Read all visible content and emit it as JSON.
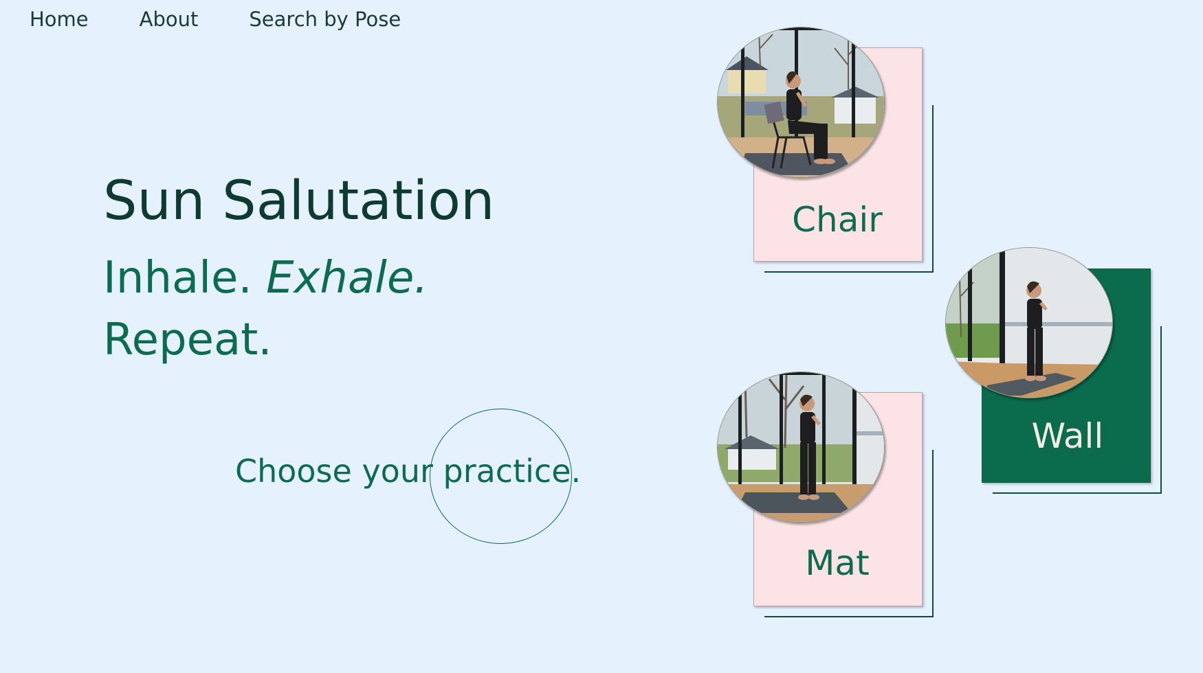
{
  "nav": {
    "items": [
      {
        "label": "Home"
      },
      {
        "label": "About"
      },
      {
        "label": "Search by Pose"
      }
    ]
  },
  "hero": {
    "title": "Sun Salutation",
    "tagline_plain": "Inhale. ",
    "tagline_italic": "Exhale.",
    "tagline_line2": "Repeat.",
    "cta": "Choose your practice."
  },
  "cards": [
    {
      "label": "Chair",
      "panel_color": "#fce4e6",
      "text_color": "#0d6b50",
      "pose": "seated-on-chair"
    },
    {
      "label": "Wall",
      "panel_color": "#0a6b4d",
      "text_color": "#f3ece6",
      "pose": "standing-at-wall"
    },
    {
      "label": "Mat",
      "panel_color": "#fce4e6",
      "text_color": "#0d6b50",
      "pose": "standing-on-mat"
    }
  ],
  "colors": {
    "background": "#e5f1fd",
    "accent": "#0d6b50",
    "heading": "#0f3a2f"
  }
}
